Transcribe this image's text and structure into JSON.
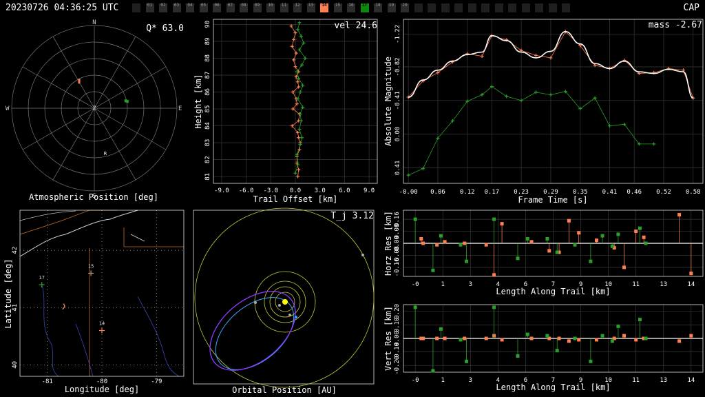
{
  "header": {
    "timestamp": "20230726 04:36:25 UTC",
    "network": "CAP"
  },
  "stations": [
    {
      "label": "",
      "state": "off"
    },
    {
      "label": "01",
      "state": "idle"
    },
    {
      "label": "02",
      "state": "idle"
    },
    {
      "label": "03",
      "state": "idle"
    },
    {
      "label": "04",
      "state": "idle"
    },
    {
      "label": "05",
      "state": "idle"
    },
    {
      "label": "06",
      "state": "idle"
    },
    {
      "label": "07",
      "state": "idle"
    },
    {
      "label": "08",
      "state": "idle"
    },
    {
      "label": "09",
      "state": "idle"
    },
    {
      "label": "10",
      "state": "idle"
    },
    {
      "label": "11",
      "state": "idle"
    },
    {
      "label": "12",
      "state": "idle"
    },
    {
      "label": "13",
      "state": "idle"
    },
    {
      "label": "14",
      "state": "orange"
    },
    {
      "label": "15",
      "state": "idle"
    },
    {
      "label": "16",
      "state": "idle"
    },
    {
      "label": "17",
      "state": "green"
    },
    {
      "label": "18",
      "state": "idle"
    },
    {
      "label": "19",
      "state": "idle"
    },
    {
      "label": "20",
      "state": "idle"
    },
    {
      "label": "",
      "state": "off"
    },
    {
      "label": "",
      "state": "off"
    },
    {
      "label": "",
      "state": "off"
    },
    {
      "label": "",
      "state": "off"
    },
    {
      "label": "",
      "state": "off"
    },
    {
      "label": "",
      "state": "off"
    },
    {
      "label": "",
      "state": "off"
    },
    {
      "label": "",
      "state": "off"
    },
    {
      "label": "",
      "state": "off"
    },
    {
      "label": "",
      "state": "off"
    },
    {
      "label": "",
      "state": "off"
    },
    {
      "label": "",
      "state": "off"
    }
  ],
  "colors": {
    "cam14": "#ff7f50",
    "cam17": "#2aa02a",
    "fit": "#ffffff",
    "grid": "#3a3a3a",
    "orbit_planet": "#c8c83a",
    "orbit_meteoroid": "#8a3cff",
    "orbit_aphelion": "#3aa0ff",
    "sun": "#ffff00"
  },
  "chart_data": [
    {
      "type": "scatter",
      "id": "polar",
      "title": "Q* 63.0",
      "xlabel": "Atmospheric Position [deg]",
      "compass": [
        "N",
        "E",
        "S",
        "W",
        "Z",
        "R"
      ],
      "series": [
        {
          "name": "14",
          "color": "#ff7f50",
          "points": [
            [
              -30,
              57
            ],
            [
              -29,
              56
            ],
            [
              -28,
              55
            ]
          ]
        },
        {
          "name": "17",
          "color": "#2aa02a",
          "points": [
            [
              76,
              55
            ],
            [
              77,
              54
            ],
            [
              78,
              53
            ]
          ]
        }
      ]
    },
    {
      "type": "scatter",
      "id": "trail",
      "title": "vel 24.6",
      "xlabel": "Trail Offset [km]",
      "ylabel": "Height [km]",
      "xticks": [
        "-9.0",
        "-6.0",
        "-3.0",
        "0.0",
        "3.0",
        "6.0",
        "9.0"
      ],
      "yticks": [
        "81",
        "82",
        "83",
        "84",
        "85",
        "86",
        "87",
        "88",
        "89",
        "90"
      ],
      "xlim": [
        -10,
        10
      ],
      "ylim": [
        80.6,
        90.3
      ],
      "series": [
        {
          "name": "14",
          "color": "#ff7f50",
          "x": [
            0.3,
            0.4,
            0.2,
            0.2,
            0.5,
            0.6,
            0.4,
            0.3,
            -0.4,
            0.4,
            0.5,
            -0.3,
            0.2,
            0.1,
            -0.3,
            0.4,
            0.3,
            0.1,
            0.4,
            0.0,
            -0.2,
            0.1,
            -0.4,
            -0.2,
            0.0,
            -0.5
          ],
          "y": [
            81.0,
            81.4,
            81.8,
            82.2,
            82.6,
            83.0,
            83.3,
            83.6,
            84.0,
            84.3,
            84.7,
            85.0,
            85.3,
            85.6,
            86.0,
            86.3,
            86.6,
            86.9,
            87.2,
            87.5,
            87.9,
            88.3,
            88.7,
            89.1,
            89.5,
            89.9
          ]
        },
        {
          "name": "17",
          "color": "#2aa02a",
          "x": [
            0.0,
            0.3,
            0.2,
            0.6,
            0.8,
            0.5,
            0.7,
            0.6,
            0.9,
            0.3,
            0.6,
            0.9,
            0.4,
            0.2,
            0.8,
            1.2,
            0.5,
            1.0,
            0.7,
            0.3,
            0.5
          ],
          "y": [
            81.2,
            81.7,
            82.3,
            82.9,
            83.3,
            83.8,
            84.3,
            84.7,
            85.1,
            85.6,
            86.0,
            86.4,
            86.8,
            87.2,
            87.6,
            88.0,
            88.5,
            88.9,
            89.3,
            89.7,
            90.1
          ]
        }
      ]
    },
    {
      "type": "line",
      "id": "magnitude",
      "title": "mass -2.67",
      "xlabel": "Frame Time [s]",
      "ylabel": "Absolute Magnitude",
      "xticks": [
        "-0.00",
        "0.06",
        "0.12",
        "0.17",
        "0.23",
        "0.29",
        "0.35",
        "0.41",
        "0.46",
        "0.52",
        "0.58"
      ],
      "yticks": [
        "-1.22",
        "-0.82",
        "-0.41",
        "0.00",
        "0.41"
      ],
      "ylim_reversed": [
        0.6,
        -1.4
      ],
      "xlim": [
        -0.01,
        0.6
      ],
      "series": [
        {
          "name": "14",
          "color": "#ff7f50",
          "x": [
            0.0,
            0.03,
            0.06,
            0.09,
            0.12,
            0.15,
            0.17,
            0.2,
            0.23,
            0.26,
            0.29,
            0.32,
            0.35,
            0.38,
            0.41,
            0.44,
            0.47,
            0.5,
            0.53,
            0.56,
            0.58
          ],
          "y": [
            -0.45,
            -0.65,
            -0.75,
            -0.88,
            -0.98,
            -0.95,
            -1.2,
            -1.15,
            -1.02,
            -0.96,
            -0.93,
            -1.25,
            -1.08,
            -0.84,
            -0.8,
            -0.9,
            -0.74,
            -0.75,
            -0.8,
            -0.78,
            -0.44
          ]
        },
        {
          "name": "17",
          "color": "#2aa02a",
          "x": [
            0.0,
            0.03,
            0.06,
            0.09,
            0.12,
            0.15,
            0.17,
            0.2,
            0.23,
            0.26,
            0.29,
            0.32,
            0.35,
            0.38,
            0.41,
            0.44,
            0.47,
            0.5
          ],
          "y": [
            0.5,
            0.42,
            0.05,
            -0.16,
            -0.4,
            -0.48,
            -0.58,
            -0.46,
            -0.41,
            -0.51,
            -0.48,
            -0.52,
            -0.31,
            -0.44,
            -0.1,
            -0.12,
            0.12,
            0.12
          ]
        },
        {
          "name": "fit",
          "color": "#ffffff",
          "x": [
            0.0,
            0.03,
            0.06,
            0.09,
            0.12,
            0.15,
            0.17,
            0.2,
            0.23,
            0.26,
            0.29,
            0.32,
            0.35,
            0.38,
            0.41,
            0.44,
            0.47,
            0.5,
            0.53,
            0.56,
            0.58
          ],
          "y": [
            -0.45,
            -0.66,
            -0.78,
            -0.89,
            -0.97,
            -1.0,
            -1.2,
            -1.14,
            -1.0,
            -0.93,
            -1.01,
            -1.25,
            -1.1,
            -0.86,
            -0.8,
            -0.89,
            -0.76,
            -0.74,
            -0.79,
            -0.76,
            -0.44
          ]
        }
      ]
    },
    {
      "type": "map",
      "id": "map",
      "xlabel": "Longitude [deg]",
      "ylabel": "Latitude [deg]",
      "xticks": [
        "-81",
        "-80",
        "-79"
      ],
      "yticks": [
        "40",
        "41",
        "42"
      ],
      "xlim": [
        -81.5,
        -78.5
      ],
      "ylim": [
        39.8,
        42.7
      ],
      "stations": [
        {
          "label": "17",
          "lon": -81.1,
          "lat": 41.4,
          "color": "#2aa02a"
        },
        {
          "label": "15",
          "lon": -80.2,
          "lat": 41.6,
          "color": "#c09080"
        },
        {
          "label": "14",
          "lon": -80.0,
          "lat": 40.6,
          "color": "#ff7f50"
        }
      ],
      "trail": {
        "lon": [
          -80.7,
          -80.68,
          -80.72
        ],
        "lat": [
          41.07,
          41.02,
          40.97
        ]
      }
    },
    {
      "type": "orbit",
      "id": "orbit",
      "title": "T_j 3.12",
      "xlabel": "Orbital Position [AU]"
    },
    {
      "type": "scatter",
      "id": "horz",
      "xlabel": "Length Along Trail [km]",
      "ylabel": "Horz Res [km]",
      "xticks": [
        "-0",
        "1",
        "3",
        "4",
        "6",
        "7",
        "9",
        "10",
        "11",
        "13",
        "14"
      ],
      "yticks": [
        "0.16",
        "0.08",
        "0.00",
        "-0.08",
        "-0.16"
      ],
      "xlim": [
        -0.6,
        14.6
      ],
      "ylim": [
        -0.22,
        0.22
      ],
      "series": [
        {
          "name": "14",
          "color": "#ff7f50",
          "x": [
            0.3,
            0.4,
            1.1,
            1.5,
            2.5,
            3.6,
            4.0,
            4.4,
            5.9,
            6.8,
            7.3,
            7.8,
            8.3,
            9.2,
            10.1,
            10.6,
            11.2,
            11.6,
            13.4,
            14.0
          ],
          "y": [
            0.03,
            0.0,
            -0.01,
            0.01,
            0.0,
            -0.01,
            -0.21,
            0.13,
            0.01,
            -0.05,
            -0.06,
            0.15,
            0.07,
            0.02,
            -0.03,
            -0.16,
            0.08,
            0.04,
            0.19,
            -0.2
          ]
        },
        {
          "name": "17",
          "color": "#2aa02a",
          "x": [
            0.0,
            0.9,
            1.3,
            2.3,
            2.6,
            4.0,
            5.2,
            5.7,
            6.7,
            7.2,
            8.1,
            8.9,
            9.5,
            10.0,
            10.3,
            11.4,
            11.7
          ],
          "y": [
            0.16,
            -0.18,
            0.05,
            -0.01,
            -0.12,
            0.16,
            -0.1,
            0.03,
            0.03,
            -0.06,
            -0.01,
            -0.12,
            0.05,
            -0.02,
            0.06,
            0.1,
            0.0
          ]
        }
      ]
    },
    {
      "type": "scatter",
      "id": "vert",
      "xlabel": "Length Along Trail [km]",
      "ylabel": "Vert Res [km]",
      "xticks": [
        "-0",
        "1",
        "3",
        "4",
        "6",
        "7",
        "9",
        "10",
        "11",
        "13",
        "14"
      ],
      "yticks": [
        "0.20",
        "0.10",
        "0.00",
        "-0.10",
        "-0.20"
      ],
      "xlim": [
        -0.6,
        14.6
      ],
      "ylim": [
        -0.25,
        0.25
      ],
      "series": [
        {
          "name": "14",
          "color": "#ff7f50",
          "x": [
            0.3,
            0.4,
            1.1,
            1.5,
            2.5,
            3.6,
            4.0,
            4.4,
            5.9,
            6.8,
            7.3,
            7.8,
            8.3,
            9.2,
            10.1,
            10.6,
            11.2,
            11.6,
            13.4,
            14.0
          ],
          "y": [
            0.0,
            0.0,
            0.0,
            0.0,
            0.0,
            0.0,
            0.02,
            -0.01,
            0.0,
            0.0,
            0.0,
            -0.02,
            -0.01,
            -0.01,
            0.0,
            0.02,
            -0.01,
            0.0,
            -0.02,
            0.02
          ]
        },
        {
          "name": "17",
          "color": "#2aa02a",
          "x": [
            0.0,
            0.9,
            1.3,
            2.3,
            2.6,
            4.0,
            5.2,
            5.7,
            6.7,
            7.2,
            8.1,
            8.9,
            9.5,
            10.0,
            10.3,
            11.4,
            11.7
          ],
          "y": [
            0.23,
            -0.24,
            0.07,
            -0.01,
            -0.17,
            0.23,
            -0.13,
            0.03,
            0.02,
            -0.09,
            0.0,
            -0.17,
            0.02,
            -0.02,
            0.09,
            0.14,
            0.0
          ]
        }
      ]
    }
  ]
}
